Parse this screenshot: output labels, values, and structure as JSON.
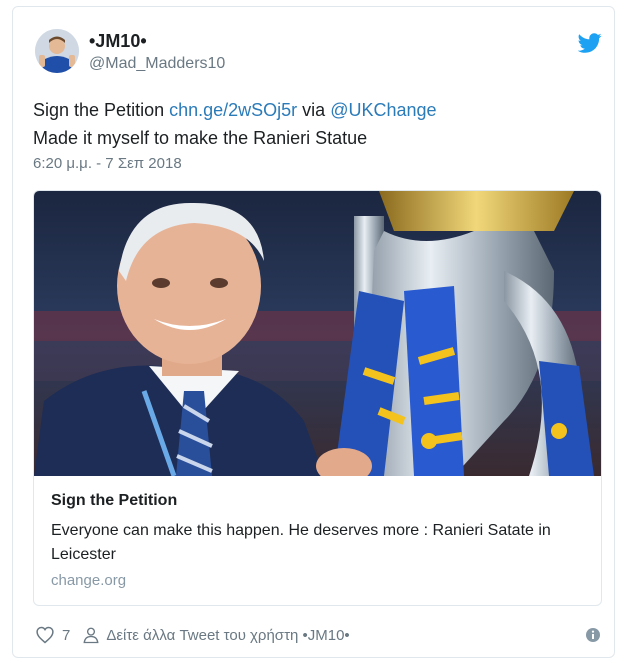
{
  "author": {
    "display_name": "•JM10•",
    "handle": "@Mad_Madders10"
  },
  "tweet": {
    "text_line1_prefix": "Sign the Petition ",
    "link_url": "chn.ge/2wSOj5r",
    "text_line1_mid": " via ",
    "mention": "@UKChange",
    "text_line2": "Made it myself to make the Ranieri Statue",
    "timestamp": "6:20 μ.μ. - 7 Σεπ 2018"
  },
  "card": {
    "image_desc_name": "ranieri-trophy-photo",
    "title": "Sign the Petition",
    "description": "Everyone can make this happen. He deserves more : Ranieri Satate in Leicester",
    "domain": "change.org"
  },
  "actions": {
    "like_count": "7",
    "see_more": "Δείτε άλλα Tweet του χρήστη •JM10•"
  },
  "colors": {
    "link": "#2b7bb9",
    "muted": "#697882",
    "twitter_blue": "#1da1f2"
  },
  "icons": [
    "twitter-bird-icon",
    "heart-icon",
    "person-icon",
    "info-icon"
  ]
}
